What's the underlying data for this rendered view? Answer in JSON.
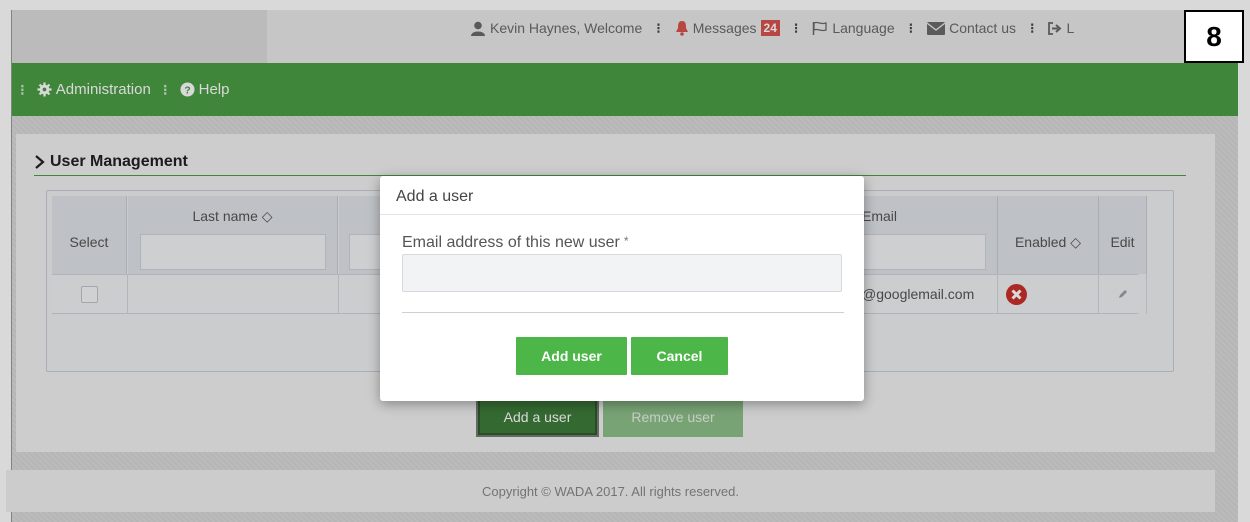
{
  "top_nav": {
    "welcome": "Kevin Haynes, Welcome",
    "messages_label": "Messages",
    "messages_count": "24",
    "language": "Language",
    "contact": "Contact us",
    "logout_partial": "L"
  },
  "step_number": "8",
  "main_nav": {
    "administration": "Administration",
    "help": "Help"
  },
  "section": {
    "title": "User Management"
  },
  "table": {
    "columns": {
      "select": "Select",
      "last_name": "Last name ◇",
      "email": "Email",
      "enabled": "Enabled ◇",
      "edit": "Edit"
    },
    "rows": [
      {
        "email": "@googlemail.com"
      }
    ]
  },
  "buttons": {
    "add_a_user": "Add a user",
    "remove_user": "Remove user"
  },
  "modal": {
    "title": "Add a user",
    "email_label": "Email address of this new user",
    "required_mark": "*",
    "email_value": "",
    "add_user": "Add user",
    "cancel": "Cancel"
  },
  "footer": {
    "copyright": "Copyright © WADA 2017. All rights reserved."
  },
  "colors": {
    "green_bar": "#4a9d45",
    "modal_button": "#4cb648",
    "badge": "#d9534f",
    "disabled_icon": "#c9302c"
  }
}
